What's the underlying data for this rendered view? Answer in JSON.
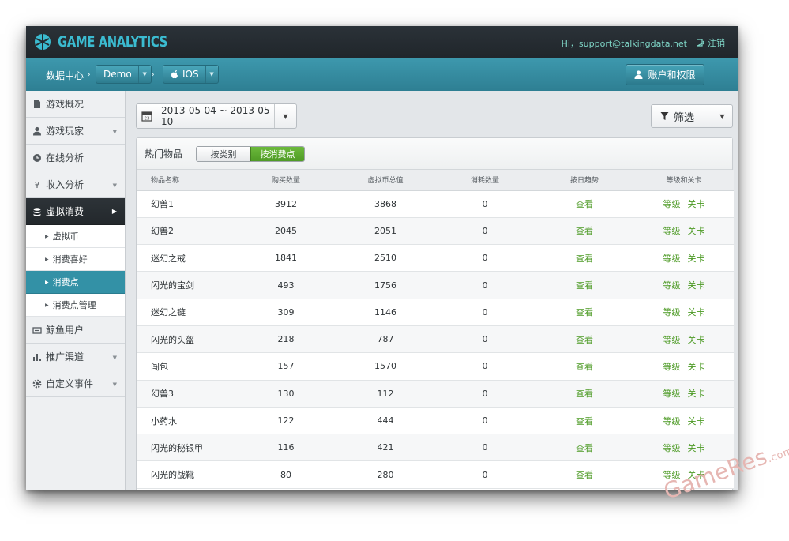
{
  "header": {
    "logo_text": "GAME ANALYTICS",
    "greeting": "Hi，support@talkingdata.net",
    "logout_label": "注销"
  },
  "subbar": {
    "home_crumb": "数据中心",
    "separator": "›",
    "game_select": "Demo",
    "platform_select": "IOS",
    "account_button": "账户和权限"
  },
  "sidebar": {
    "items": [
      {
        "label": "游戏概况",
        "icon": "document-icon",
        "has_arrow": false
      },
      {
        "label": "游戏玩家",
        "icon": "user-icon",
        "has_arrow": true
      },
      {
        "label": "在线分析",
        "icon": "clock-icon",
        "has_arrow": false
      },
      {
        "label": "收入分析",
        "icon": "yen-icon",
        "has_arrow": true
      },
      {
        "label": "虚拟消费",
        "icon": "coins-icon",
        "has_arrow": true,
        "active": true
      },
      {
        "label": "鲸鱼用户",
        "icon": "card-icon",
        "has_arrow": false
      },
      {
        "label": "推广渠道",
        "icon": "bar-chart-icon",
        "has_arrow": true
      },
      {
        "label": "自定义事件",
        "icon": "gear-icon",
        "has_arrow": true
      }
    ],
    "sub_items": [
      {
        "label": "虚拟币"
      },
      {
        "label": "消费喜好"
      },
      {
        "label": "消费点",
        "active": true
      },
      {
        "label": "消费点管理"
      }
    ]
  },
  "toolbar": {
    "date_range": "2013-05-04 ~ 2013-05-10",
    "filter_label": "筛选"
  },
  "panel": {
    "title": "热门物品",
    "toggle": [
      "按类别",
      "按消费点"
    ],
    "toggle_selected": "按消费点"
  },
  "table": {
    "columns": [
      "物品名称",
      "购买数量",
      "虚拟币总值",
      "消耗数量",
      "按日趋势",
      "等级和关卡"
    ],
    "link_view": "查看",
    "link_level": "等级",
    "link_stage": "关卡",
    "rows": [
      {
        "name": "幻兽1",
        "bought": "3912",
        "total": "3868",
        "consumed": "0"
      },
      {
        "name": "幻兽2",
        "bought": "2045",
        "total": "2051",
        "consumed": "0"
      },
      {
        "name": "迷幻之戒",
        "bought": "1841",
        "total": "2510",
        "consumed": "0"
      },
      {
        "name": "闪光的宝剑",
        "bought": "493",
        "total": "1756",
        "consumed": "0"
      },
      {
        "name": "迷幻之链",
        "bought": "309",
        "total": "1146",
        "consumed": "0"
      },
      {
        "name": "闪光的头盔",
        "bought": "218",
        "total": "787",
        "consumed": "0"
      },
      {
        "name": "闯包",
        "bought": "157",
        "total": "1570",
        "consumed": "0"
      },
      {
        "name": "幻兽3",
        "bought": "130",
        "total": "112",
        "consumed": "0"
      },
      {
        "name": "小药水",
        "bought": "122",
        "total": "444",
        "consumed": "0"
      },
      {
        "name": "闪光的秘银甲",
        "bought": "116",
        "total": "421",
        "consumed": "0"
      },
      {
        "name": "闪光的战靴",
        "bought": "80",
        "total": "280",
        "consumed": "0"
      }
    ]
  },
  "watermark": {
    "text": "GameRes",
    "suffix": ".com"
  },
  "colors": {
    "header_bg": "#23292e",
    "subbar_bg": "#3589a0",
    "accent_teal": "#3bbbd0",
    "active_sub": "#3391a6",
    "link_green": "#4c9a24",
    "toggle_green": "#5aa92d"
  }
}
